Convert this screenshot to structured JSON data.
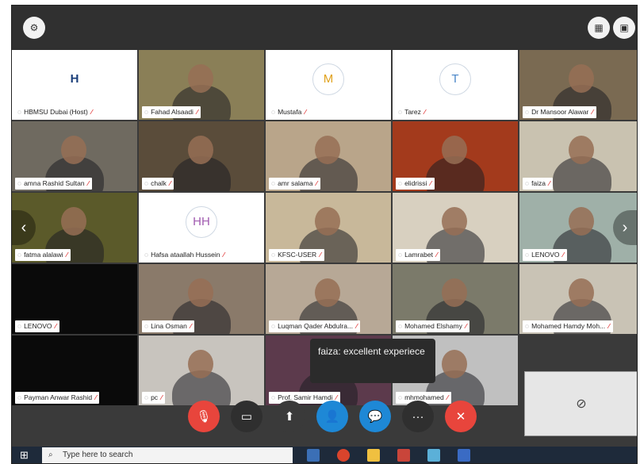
{
  "topbar": {
    "left_icon": "settings-icon",
    "right_icons": [
      "grid-view-icon",
      "layout-icon"
    ]
  },
  "tiles": [
    {
      "name": "HBMSU Dubai (Host)",
      "avatar": "logo",
      "bg": "#ffffff"
    },
    {
      "name": "Fahad Alsaadi",
      "bg": "#8a7f57"
    },
    {
      "name": "Mustafa",
      "avatar": "M",
      "avatar_color": "#e0a11a",
      "bg": "#ffffff"
    },
    {
      "name": "Tarez",
      "avatar": "T",
      "avatar_color": "#4a86c8",
      "bg": "#ffffff"
    },
    {
      "name": "Dr Mansoor Alawar",
      "bg": "#7a6a52"
    },
    {
      "name": "amna Rashid Sultan",
      "bg": "#6f6a60"
    },
    {
      "name": "chalk",
      "bg": "#5a4c3a"
    },
    {
      "name": "amr salama",
      "bg": "#b9a58a"
    },
    {
      "name": "elidrissi",
      "bg": "#a33a1c"
    },
    {
      "name": "faiza",
      "bg": "#c9c2b0"
    },
    {
      "name": "fatma alalawi",
      "bg": "#5b5a2a"
    },
    {
      "name": "Hafsa ataallah Hussein",
      "avatar": "HH",
      "avatar_color": "#a15bb0",
      "bg": "#ffffff"
    },
    {
      "name": "KFSC-USER",
      "bg": "#c8b89a"
    },
    {
      "name": "Lamrabet",
      "bg": "#d8d0c0"
    },
    {
      "name": "LENOVO",
      "bg": "#9fb0a8"
    },
    {
      "name": "LENOVO",
      "bg": "#0a0a0a"
    },
    {
      "name": "Lina Osman",
      "bg": "#8a7a6a"
    },
    {
      "name": "Luqman Qader Abdulra...",
      "bg": "#b7a896"
    },
    {
      "name": "Mohamed Elshamy",
      "bg": "#7b7a6a"
    },
    {
      "name": "Mohamed Hamdy Moh...",
      "bg": "#c9c3b5"
    },
    {
      "name": "Payman Anwar Rashid",
      "bg": "#0a0a0a"
    },
    {
      "name": "pc",
      "bg": "#c8c4be"
    },
    {
      "name": "Prof. Samir Hamdi",
      "bg": "#5c3a4c"
    },
    {
      "name": "mhmohamed",
      "bg": "#c0c0c0"
    }
  ],
  "chat_popup": {
    "text": "faiza: excellent experiece"
  },
  "toolbar": {
    "buttons": [
      {
        "name": "mute-mic-button",
        "icon": "mic-off-icon",
        "glyph": "🎙",
        "color": "#e8453c"
      },
      {
        "name": "camera-button",
        "icon": "camera-off-icon",
        "glyph": "▭",
        "color": "#2f2f2f"
      },
      {
        "name": "share-screen-button",
        "icon": "share-screen-icon",
        "glyph": "⬆",
        "color": "#3a3a3a"
      },
      {
        "name": "participants-button",
        "icon": "participants-icon",
        "glyph": "👤",
        "color": "#1e88d6"
      },
      {
        "name": "chat-button",
        "icon": "chat-icon",
        "glyph": "💬",
        "color": "#1e88d6"
      },
      {
        "name": "more-button",
        "icon": "more-icon",
        "glyph": "···",
        "color": "#2f2f2f"
      },
      {
        "name": "leave-button",
        "icon": "close-icon",
        "glyph": "✕",
        "color": "#e8453c"
      }
    ]
  },
  "taskbar": {
    "search_placeholder": "Type here to search"
  }
}
